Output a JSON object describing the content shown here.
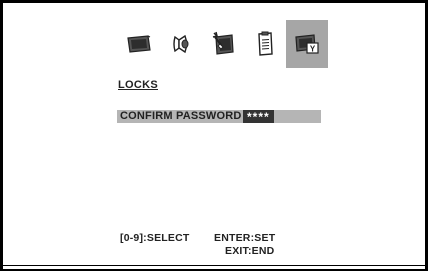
{
  "menu": {
    "icons": [
      {
        "name": "picture-icon",
        "selected": false
      },
      {
        "name": "audio-icon",
        "selected": false
      },
      {
        "name": "setup-icon",
        "selected": false
      },
      {
        "name": "guide-icon",
        "selected": false
      },
      {
        "name": "locks-icon",
        "selected": true
      }
    ],
    "selected_color": "#a6a6a6"
  },
  "locks": {
    "title": "LOCKS",
    "confirm_password_label": "CONFIRM PASSWORD",
    "password_value": "****"
  },
  "footer": {
    "select_hint": "[0-9]:SELECT",
    "set_hint": "ENTER:SET",
    "exit_hint": "EXIT:END"
  }
}
